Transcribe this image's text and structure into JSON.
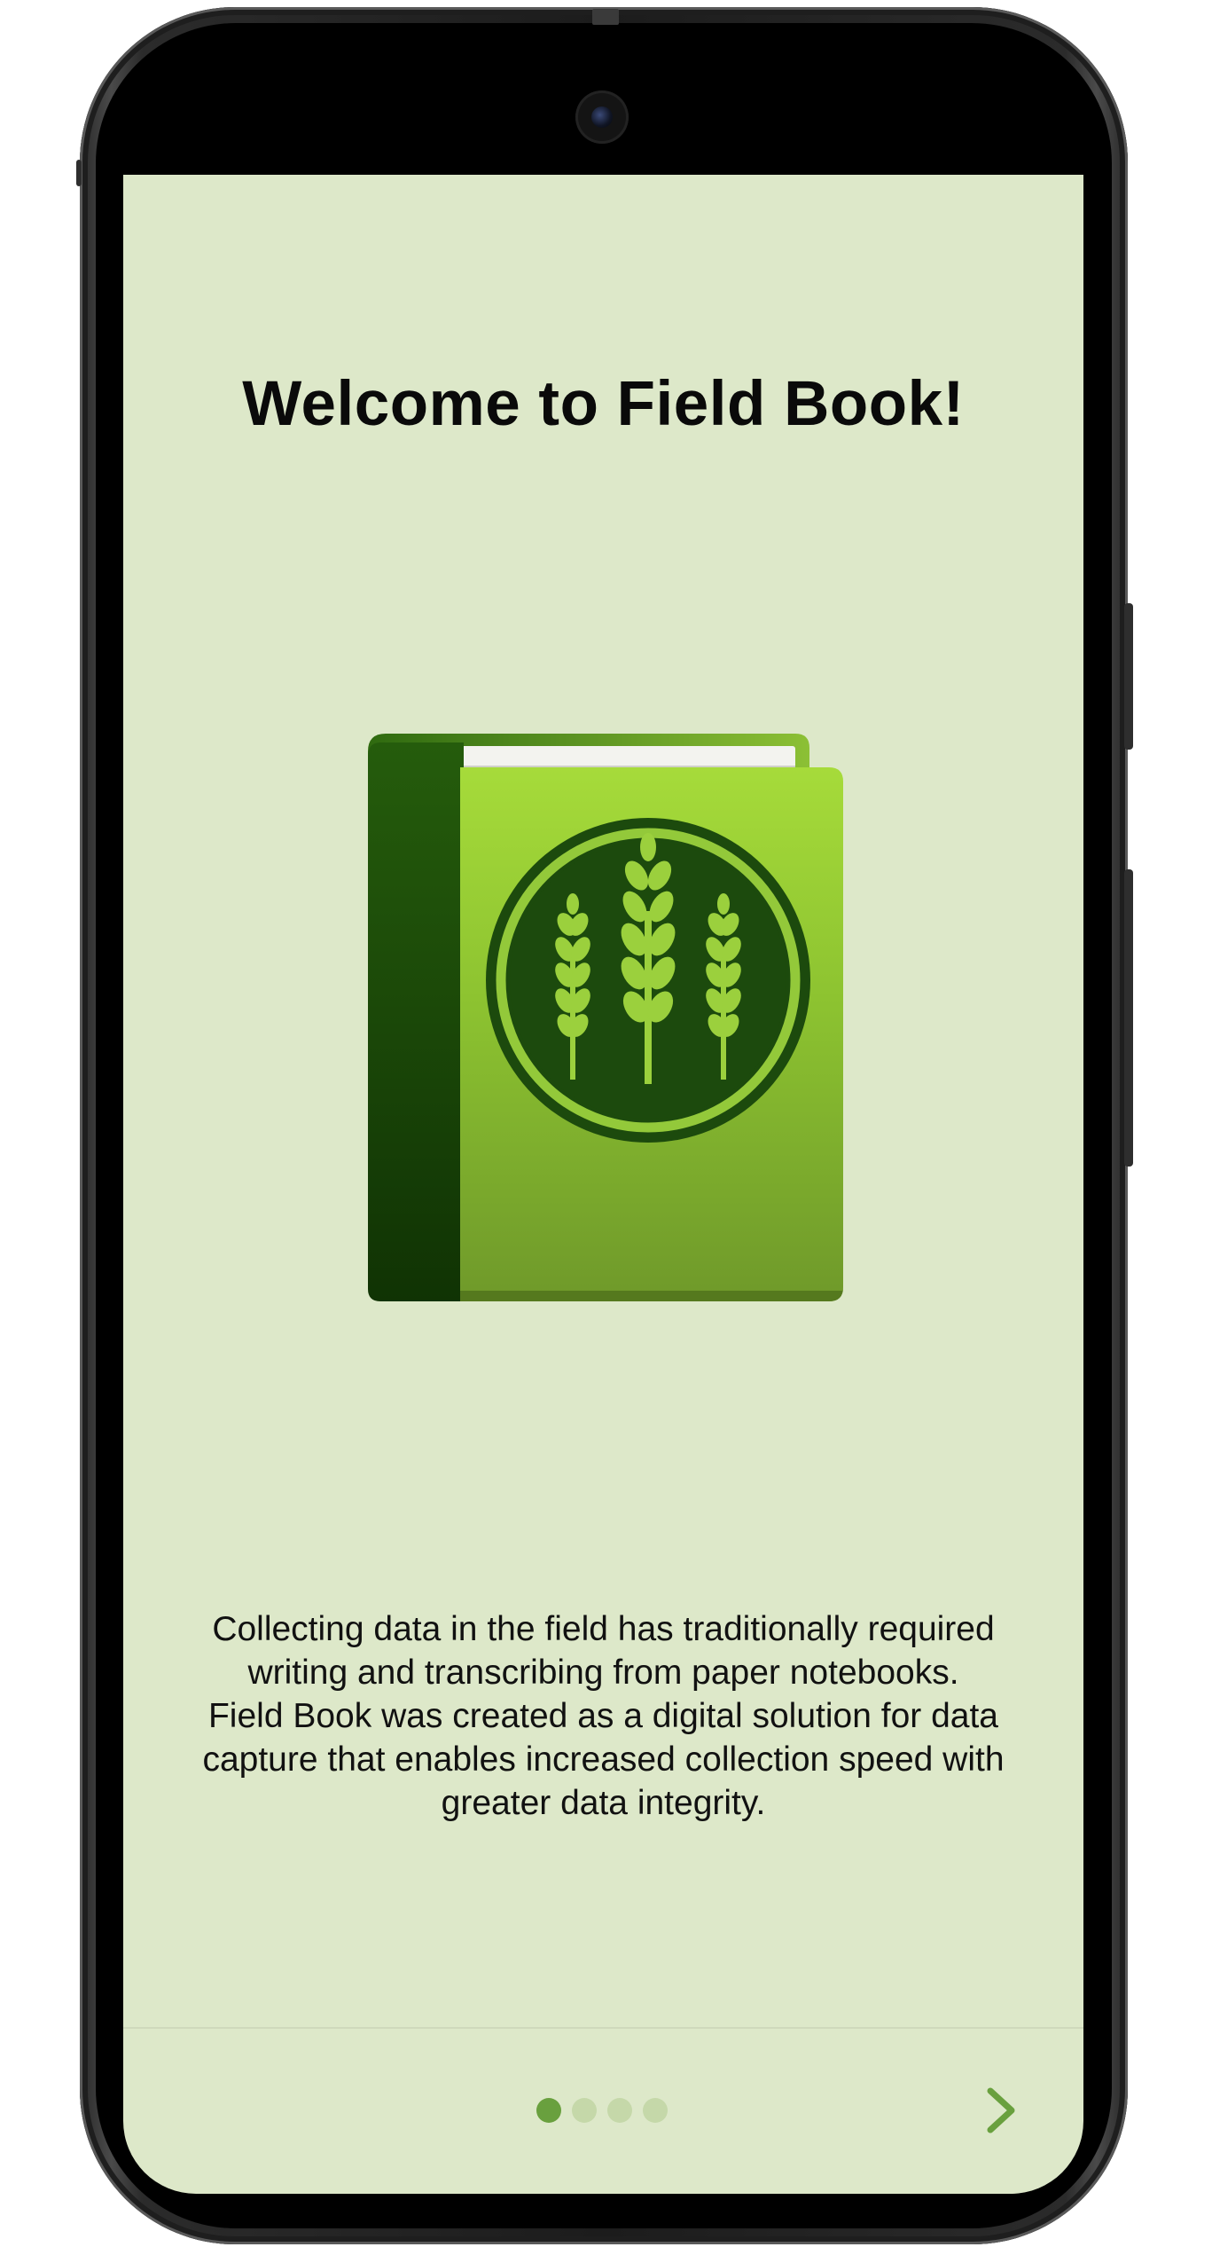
{
  "screen": {
    "title": "Welcome to Field Book!",
    "description": "Collecting data in the field has traditionally required\nwriting and transcribing from paper notebooks.\nField Book was created as a digital solution for data\ncapture that enables increased collection speed with\ngreater data integrity.",
    "app_icon": "field-book-logo",
    "pager": {
      "pages": 4,
      "current_page": 1
    },
    "next_icon": "chevron-right-icon"
  },
  "colors": {
    "background": "#dde8c9",
    "accent": "#69a03e",
    "inactive_dot": "#c5d8a9"
  }
}
